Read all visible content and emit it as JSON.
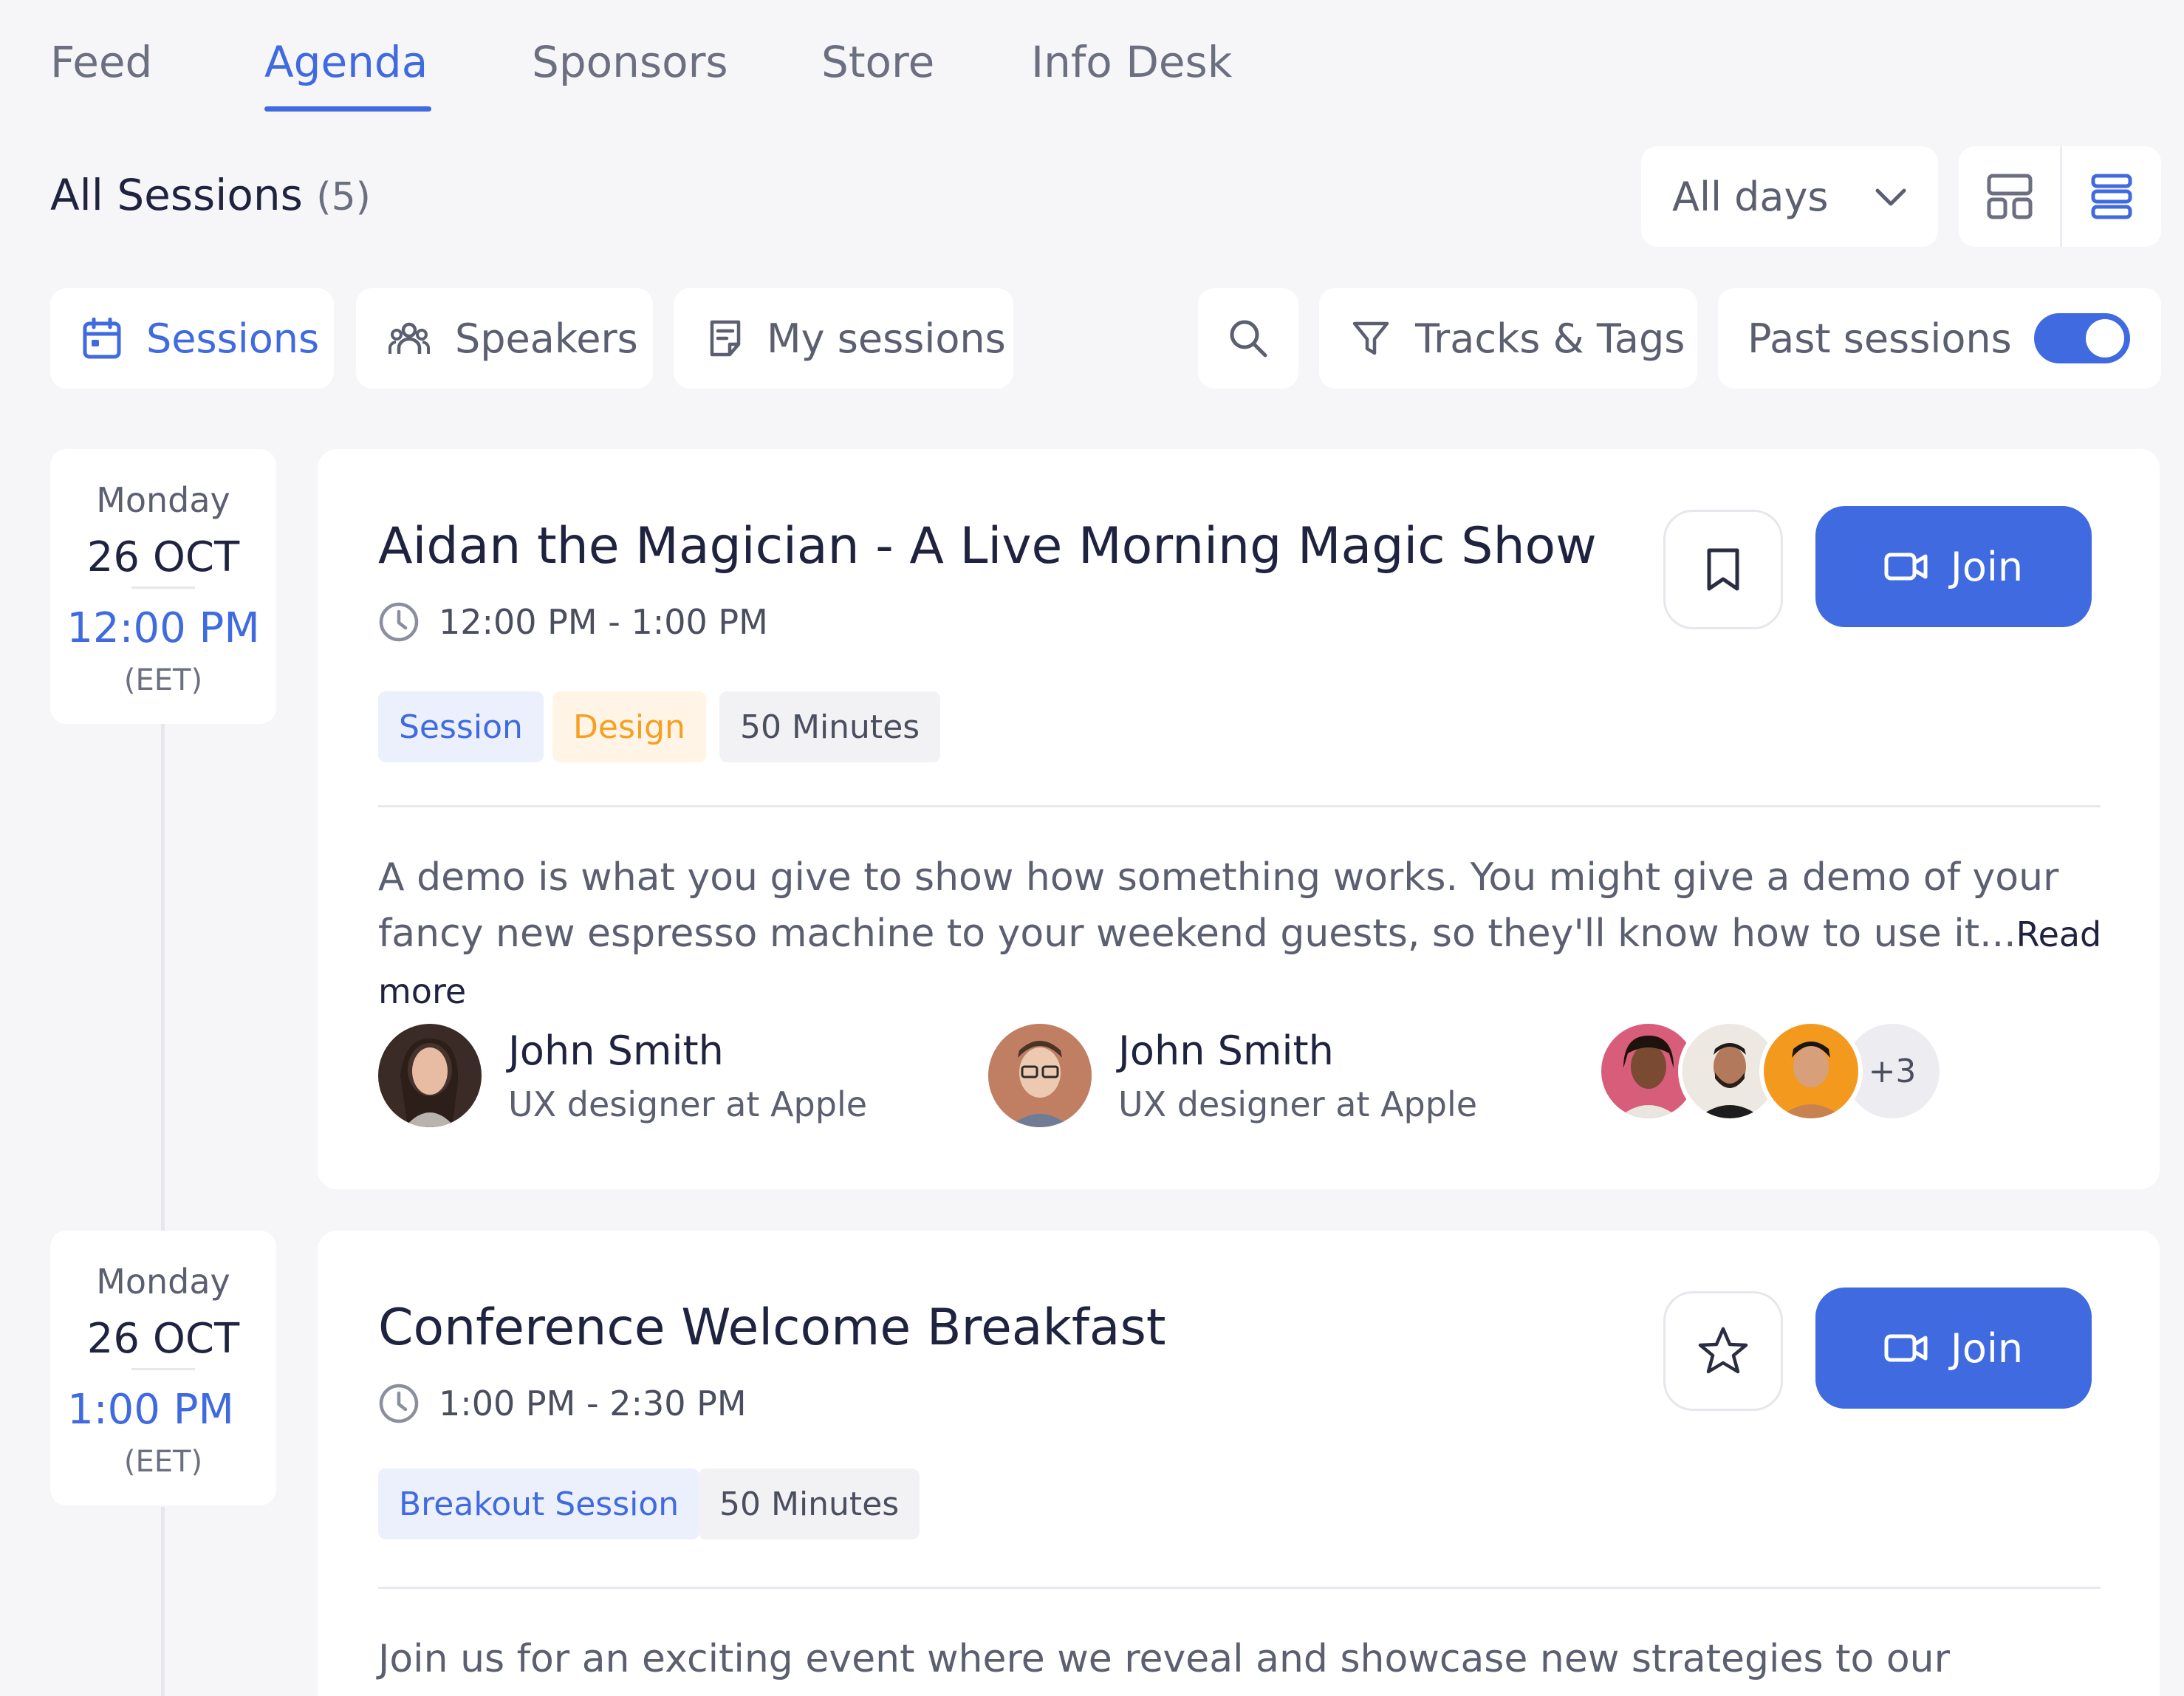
{
  "nav": {
    "tabs": [
      {
        "label": "Feed"
      },
      {
        "label": "Agenda",
        "active": true
      },
      {
        "label": "Sponsors"
      },
      {
        "label": "Store"
      },
      {
        "label": "Info Desk"
      }
    ]
  },
  "header": {
    "title": "All Sessions",
    "count": "(5)",
    "days_select": "All days",
    "view_modes": [
      {
        "icon": "grid-layout-icon",
        "active": false
      },
      {
        "icon": "list-layout-icon",
        "active": true
      }
    ]
  },
  "filters": {
    "sessions": "Sessions",
    "speakers": "Speakers",
    "my_sessions": "My sessions",
    "tracks_tags": "Tracks & Tags",
    "past_sessions": "Past sessions",
    "past_sessions_on": true
  },
  "colors": {
    "accent": "#3f6ae0",
    "background": "#f6f6f9",
    "tag_orange": "#f5a021"
  },
  "sessions": [
    {
      "weekday": "Monday",
      "date": "26 OCT",
      "start": "12:00 PM",
      "tz": "(EET)",
      "title": "Aidan the Magician - A Live Morning Magic Show",
      "time_range": "12:00 PM - 1:00 PM",
      "tags": [
        "Session",
        "Design",
        "50 Minutes"
      ],
      "description": "A demo is what you give to show how something works. You might give a demo of your fancy new espresso machine to your weekend guests, so they'll know how to use it...",
      "read_more": "Read more",
      "action_icon": "bookmark-icon",
      "join_label": "Join",
      "speakers": [
        {
          "name": "John Smith",
          "role": "UX designer at Apple"
        },
        {
          "name": "John Smith",
          "role": "UX designer at Apple"
        }
      ],
      "extra_count": "+3"
    },
    {
      "weekday": "Monday",
      "date": "26 OCT",
      "start": "1:00 PM",
      "tz": "(EET)",
      "title": "Conference Welcome Breakfast",
      "time_range": "1:00 PM - 2:30 PM",
      "tags": [
        "Breakout Session",
        "50 Minutes"
      ],
      "description": "Join us for an exciting event where we reveal and showcase new strategies to our",
      "action_icon": "star-icon",
      "join_label": "Join"
    }
  ]
}
